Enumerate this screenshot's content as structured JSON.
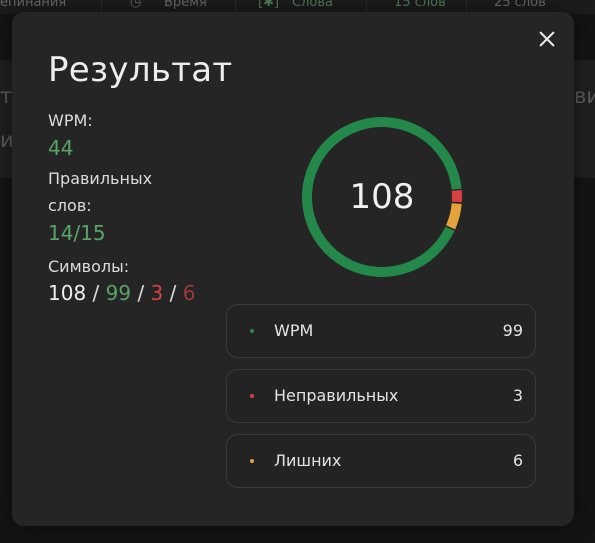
{
  "background": {
    "top_items": [
      "епинания",
      "Время",
      "Слова",
      "15 слов",
      "25 слов"
    ],
    "frag_left_1": "т",
    "frag_left_2": "из",
    "frag_right": "ви"
  },
  "modal": {
    "title": "Результат",
    "wpm_label": "WPM:",
    "wpm_value": "44",
    "correct_words_label_1": "Правильных",
    "correct_words_label_2": "слов:",
    "correct_words_value": "14/15",
    "symbols_label": "Символы:",
    "symbols": {
      "total": "108",
      "correct": "99",
      "incorrect": "3",
      "extra": "6",
      "separator": " / "
    },
    "ring": {
      "center_value": "108",
      "segments": [
        {
          "name": "WPM",
          "value": 99,
          "color": "#24884a"
        },
        {
          "name": "Неправильных",
          "value": 3,
          "color": "#d94040"
        },
        {
          "name": "Лишних",
          "value": 6,
          "color": "#e2a43a"
        }
      ]
    },
    "legend": [
      {
        "label": "WPM",
        "value": "99",
        "color": "#2c8a4a"
      },
      {
        "label": "Неправильных",
        "value": "3",
        "color": "#d94040"
      },
      {
        "label": "Лишних",
        "value": "6",
        "color": "#e2a43a"
      }
    ],
    "close_icon": "close-icon"
  }
}
